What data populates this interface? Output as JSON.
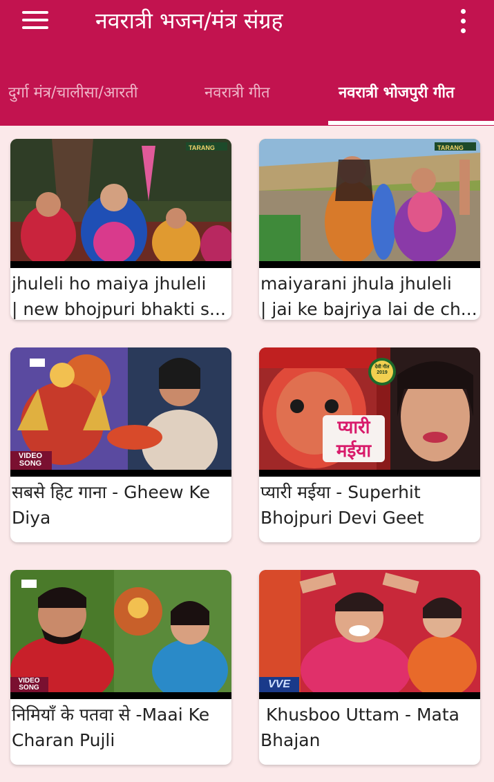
{
  "app": {
    "title": "नवरात्री भजन/मंत्र संग्रह",
    "menu_icon": "hamburger-menu-icon",
    "more_icon": "more-vertical-icon",
    "accent_color": "#c2134f",
    "background_color": "#fbe9ea"
  },
  "tabs": [
    {
      "label": "दुर्गा मंत्र/चालीसा/आरती",
      "active": false
    },
    {
      "label": "नवरात्री गीत",
      "active": false
    },
    {
      "label": "नवरात्री भोजपुरी गीत",
      "active": true
    }
  ],
  "videos": [
    {
      "title_line1": "jhuleli ho maiya jhuleli",
      "title_line2": "| new bhojpuri bhakti s...",
      "watermark": "TARANG"
    },
    {
      "title_line1": "maiyarani jhula jhuleli",
      "title_line2": "| jai ke bajriya lai de ch...",
      "watermark": "TARANG"
    },
    {
      "title": "सबसे हिट गाना - Gheew Ke Diya",
      "badge": "VIDEO SONG"
    },
    {
      "title": "प्यारी मईया - Superhit Bhojpuri Devi Geet",
      "overlay_text": "प्यारी मईया",
      "badge": "देवी गीत 2019"
    },
    {
      "title": "निमियाँ के पतवा से -Maai Ke Charan Pujli",
      "badge": "VIDEO SONG"
    },
    {
      "title": " Khusboo Uttam - Mata Bhajan",
      "overlay_text": "VVE"
    }
  ]
}
